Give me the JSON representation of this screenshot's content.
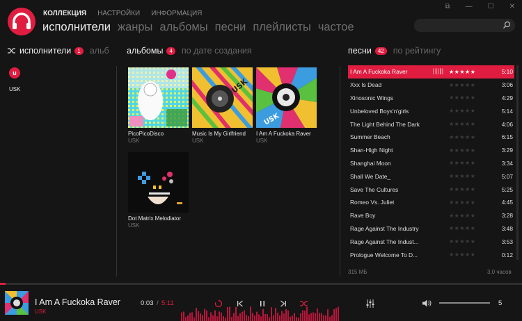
{
  "topnav": [
    {
      "label": "КОЛЛЕКЦИЯ",
      "active": true
    },
    {
      "label": "НАСТРОЙКИ",
      "active": false
    },
    {
      "label": "ИНФОРМАЦИЯ",
      "active": false
    }
  ],
  "mainnav": [
    {
      "label": "исполнители",
      "active": true
    },
    {
      "label": "жанры",
      "active": false
    },
    {
      "label": "альбомы",
      "active": false
    },
    {
      "label": "песни",
      "active": false
    },
    {
      "label": "плейлисты",
      "active": false
    },
    {
      "label": "частое",
      "active": false
    }
  ],
  "artists_section": {
    "title": "исполнители",
    "count": "1",
    "sort": "альб"
  },
  "artists": [
    {
      "initial": "u",
      "name": "USK"
    }
  ],
  "albums_section": {
    "title": "альбомы",
    "count": "4",
    "sort": "по дате создания"
  },
  "albums": [
    {
      "name": "PicoPicoDisco",
      "artist": "USK"
    },
    {
      "name": "Music Is My Girlfriend",
      "artist": "USK"
    },
    {
      "name": "I Am A Fuckoka Raver",
      "artist": "USK"
    },
    {
      "name": "Dot Matrix Melodiator",
      "artist": "USK"
    }
  ],
  "songs_section": {
    "title": "песни",
    "count": "42",
    "sort": "по рейтингу"
  },
  "songs": [
    {
      "title": "I Am A Fuckoka Raver",
      "duration": "5:10",
      "rating": 5,
      "playing": true
    },
    {
      "title": "Xxx Is Dead",
      "duration": "3:06",
      "rating": 0,
      "playing": false
    },
    {
      "title": "Xinosonic Wings",
      "duration": "4:29",
      "rating": 0,
      "playing": false
    },
    {
      "title": "Unbeloved Boys'n'girls",
      "duration": "5:14",
      "rating": 0,
      "playing": false
    },
    {
      "title": "The Light Behind The Dark",
      "duration": "4:06",
      "rating": 0,
      "playing": false
    },
    {
      "title": "Summer Beach",
      "duration": "6:15",
      "rating": 0,
      "playing": false
    },
    {
      "title": "Shan-High Night",
      "duration": "3:29",
      "rating": 0,
      "playing": false
    },
    {
      "title": "Shanghai Moon",
      "duration": "3:34",
      "rating": 0,
      "playing": false
    },
    {
      "title": "Shall We Date_",
      "duration": "5:07",
      "rating": 0,
      "playing": false
    },
    {
      "title": "Save The Cultures",
      "duration": "5:25",
      "rating": 0,
      "playing": false
    },
    {
      "title": "Romeo Vs. Juliet",
      "duration": "4:45",
      "rating": 0,
      "playing": false
    },
    {
      "title": "Rave Boy",
      "duration": "3:28",
      "rating": 0,
      "playing": false
    },
    {
      "title": "Rage Against The Industry",
      "duration": "3:48",
      "rating": 0,
      "playing": false
    },
    {
      "title": "Rage Against The Indust...",
      "duration": "3:53",
      "rating": 0,
      "playing": false
    },
    {
      "title": "Prologue Welcome To D...",
      "duration": "0:12",
      "rating": 0,
      "playing": false
    }
  ],
  "songs_footer": {
    "size": "315 МБ",
    "total_time": "3,0 часов"
  },
  "player": {
    "title": "I Am A Fuckoka Raver",
    "artist": "USK",
    "elapsed": "0:03",
    "separator": "/",
    "total": "5:11",
    "progress_fraction": 0.01,
    "volume_fraction": 1.0,
    "volume": "5"
  },
  "icons": {
    "logo": "headphones-logo",
    "search": "search-icon",
    "shuffle": "shuffle-icon",
    "repeat": "repeat-icon",
    "prev": "previous-icon",
    "pause": "pause-icon",
    "next": "next-icon",
    "equalizer": "equalizer-icon",
    "volume": "volume-icon"
  },
  "colors": {
    "accent": "#e01d40",
    "background": "#151515",
    "text": "#d8d8d8",
    "dim": "#6d6d6d"
  }
}
